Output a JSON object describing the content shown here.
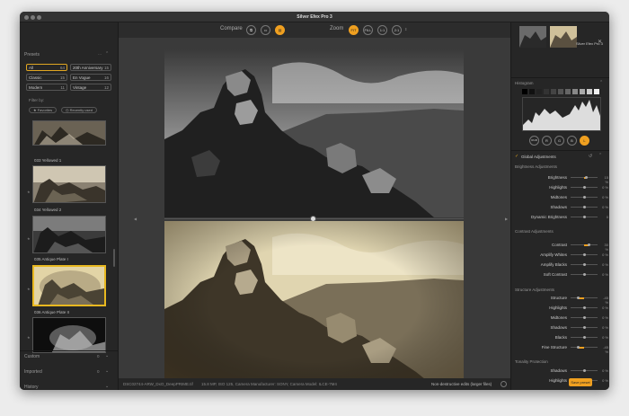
{
  "app": {
    "title": "Silver Efex Pro 3"
  },
  "top": {
    "compare": "Compare",
    "zoom": "Zoom",
    "zoom_opts": [
      "FIT",
      "FILL",
      "1:1",
      "2:1"
    ]
  },
  "presets": {
    "title": "Presets",
    "filters": [
      {
        "label": "All",
        "count": "64"
      },
      {
        "label": "20th Anniversary",
        "count": "15"
      },
      {
        "label": "Classic",
        "count": "15"
      },
      {
        "label": "En Vogue",
        "count": "16"
      },
      {
        "label": "Modern",
        "count": "11"
      },
      {
        "label": "Vintage",
        "count": "12"
      }
    ],
    "filter_by": "Filter by:",
    "pills": [
      "Favorites",
      "Recently used"
    ],
    "thumbs": [
      "033 Yellowed 1",
      "034 Yellowed 2",
      "035 Antique Plate I",
      "036 Antique Plate II"
    ],
    "custom": "Custom",
    "custom_count": "0",
    "imported": "Imported",
    "imported_count": "0",
    "history": "History"
  },
  "right": {
    "app_label": "Silver Efex Pro 3",
    "histogram": "Histogram",
    "channels": [
      "RGB",
      "R",
      "G",
      "B",
      "L"
    ],
    "global": "Global Adjustments",
    "brightness_title": "Brightness Adjustments",
    "brightness": [
      {
        "label": "Brightness",
        "value": "15 %"
      },
      {
        "label": "Highlights",
        "value": "0 %"
      },
      {
        "label": "Midtones",
        "value": "0 %"
      },
      {
        "label": "Shadows",
        "value": "0 %"
      },
      {
        "label": "Dynamic Brightness",
        "value": "0"
      }
    ],
    "contrast_title": "Contrast Adjustments",
    "contrast": [
      {
        "label": "Contrast",
        "value": "30 %"
      },
      {
        "label": "Amplify Whites",
        "value": "0 %"
      },
      {
        "label": "Amplify Blacks",
        "value": "0 %"
      },
      {
        "label": "Soft Contrast",
        "value": "0 %"
      }
    ],
    "structure_title": "Structure Adjustments",
    "structure": [
      {
        "label": "Structure",
        "value": "-45 %"
      },
      {
        "label": "Highlights",
        "value": "0 %"
      },
      {
        "label": "Midtones",
        "value": "0 %"
      },
      {
        "label": "Shadows",
        "value": "0 %"
      },
      {
        "label": "Blacks",
        "value": "0 %"
      },
      {
        "label": "Fine Structure",
        "value": "-45 %"
      }
    ],
    "tonality_title": "Tonality Protection",
    "tonality": [
      {
        "label": "Shadows",
        "value": "0 %"
      },
      {
        "label": "Highlights",
        "value": "0 %"
      }
    ],
    "save": "Save preset"
  },
  "status": {
    "file": "DSC02744-ARW_DxO_DeepPRIME.tif",
    "info": "15.8 MP, ISO 125, Camera Manufacturer: SONY, Camera Model: ILCE-7M4",
    "nondestructive": "Non-destructive edits (larger files)"
  },
  "colors": {
    "accent": "#f0a020",
    "sepia": "#c9bc96"
  }
}
